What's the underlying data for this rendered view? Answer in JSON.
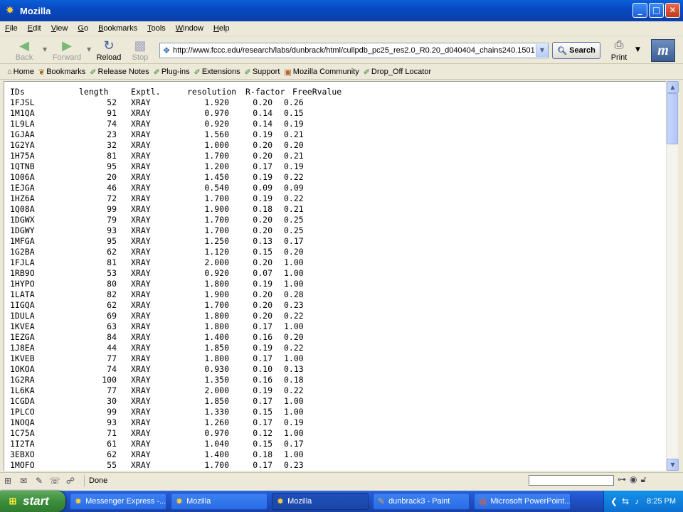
{
  "window": {
    "title": "Mozilla"
  },
  "menu": [
    {
      "label": "File",
      "key": "F",
      "rest": "ile"
    },
    {
      "label": "Edit",
      "key": "E",
      "rest": "dit"
    },
    {
      "label": "View",
      "key": "V",
      "rest": "iew"
    },
    {
      "label": "Go",
      "key": "G",
      "rest": "o"
    },
    {
      "label": "Bookmarks",
      "key": "B",
      "rest": "ookmarks"
    },
    {
      "label": "Tools",
      "key": "T",
      "rest": "ools"
    },
    {
      "label": "Window",
      "key": "W",
      "rest": "indow"
    },
    {
      "label": "Help",
      "key": "H",
      "rest": "elp"
    }
  ],
  "nav": {
    "back_label": "Back",
    "forward_label": "Forward",
    "reload_label": "Reload",
    "stop_label": "Stop",
    "url": "http://www.fccc.edu/research/labs/dunbrack/html/cullpdb_pc25_res2.0_R0.20_d040404_chains240.1501",
    "search_label": "Search",
    "print_label": "Print"
  },
  "bookmarks": [
    {
      "label": "Home",
      "icon": "home-icon"
    },
    {
      "label": "Bookmarks",
      "icon": "bookmarks-icon"
    },
    {
      "label": "Release Notes",
      "icon": "link-icon"
    },
    {
      "label": "Plug-ins",
      "icon": "link-icon"
    },
    {
      "label": "Extensions",
      "icon": "link-icon"
    },
    {
      "label": "Support",
      "icon": "link-icon"
    },
    {
      "label": "Mozilla Community",
      "icon": "folder-icon"
    },
    {
      "label": "Drop_Off Locator",
      "icon": "link-icon"
    }
  ],
  "table": {
    "headers": [
      "IDs",
      "length",
      "Exptl.",
      "resolution",
      "R-factor",
      "FreeRvalue"
    ],
    "rows": [
      [
        "1FJSL",
        "52",
        "XRAY",
        "1.920",
        "0.20",
        "0.26"
      ],
      [
        "1M1QA",
        "91",
        "XRAY",
        "0.970",
        "0.14",
        "0.15"
      ],
      [
        "1L9LA",
        "74",
        "XRAY",
        "0.920",
        "0.14",
        "0.19"
      ],
      [
        "1GJAA",
        "23",
        "XRAY",
        "1.560",
        "0.19",
        "0.21"
      ],
      [
        "1G2YA",
        "32",
        "XRAY",
        "1.000",
        "0.20",
        "0.20"
      ],
      [
        "1H75A",
        "81",
        "XRAY",
        "1.700",
        "0.20",
        "0.21"
      ],
      [
        "1QTNB",
        "95",
        "XRAY",
        "1.200",
        "0.17",
        "0.19"
      ],
      [
        "1O06A",
        "20",
        "XRAY",
        "1.450",
        "0.19",
        "0.22"
      ],
      [
        "1EJGA",
        "46",
        "XRAY",
        "0.540",
        "0.09",
        "0.09"
      ],
      [
        "1HZ6A",
        "72",
        "XRAY",
        "1.700",
        "0.19",
        "0.22"
      ],
      [
        "1Q08A",
        "99",
        "XRAY",
        "1.900",
        "0.18",
        "0.21"
      ],
      [
        "1DGWX",
        "79",
        "XRAY",
        "1.700",
        "0.20",
        "0.25"
      ],
      [
        "1DGWY",
        "93",
        "XRAY",
        "1.700",
        "0.20",
        "0.25"
      ],
      [
        "1MFGA",
        "95",
        "XRAY",
        "1.250",
        "0.13",
        "0.17"
      ],
      [
        "1G2BA",
        "62",
        "XRAY",
        "1.120",
        "0.15",
        "0.20"
      ],
      [
        "1FJLA",
        "81",
        "XRAY",
        "2.000",
        "0.20",
        "1.00"
      ],
      [
        "1RB9O",
        "53",
        "XRAY",
        "0.920",
        "0.07",
        "1.00"
      ],
      [
        "1HYPO",
        "80",
        "XRAY",
        "1.800",
        "0.19",
        "1.00"
      ],
      [
        "1LATA",
        "82",
        "XRAY",
        "1.900",
        "0.20",
        "0.28"
      ],
      [
        "1IGQA",
        "62",
        "XRAY",
        "1.700",
        "0.20",
        "0.23"
      ],
      [
        "1DULA",
        "69",
        "XRAY",
        "1.800",
        "0.20",
        "0.22"
      ],
      [
        "1KVEA",
        "63",
        "XRAY",
        "1.800",
        "0.17",
        "1.00"
      ],
      [
        "1EZGA",
        "84",
        "XRAY",
        "1.400",
        "0.16",
        "0.20"
      ],
      [
        "1J8EA",
        "44",
        "XRAY",
        "1.850",
        "0.19",
        "0.22"
      ],
      [
        "1KVEB",
        "77",
        "XRAY",
        "1.800",
        "0.17",
        "1.00"
      ],
      [
        "1OKOA",
        "74",
        "XRAY",
        "0.930",
        "0.10",
        "0.13"
      ],
      [
        "1G2RA",
        "100",
        "XRAY",
        "1.350",
        "0.16",
        "0.18"
      ],
      [
        "1L6KA",
        "77",
        "XRAY",
        "2.000",
        "0.19",
        "0.22"
      ],
      [
        "1CGDA",
        "30",
        "XRAY",
        "1.850",
        "0.17",
        "1.00"
      ],
      [
        "1PLCO",
        "99",
        "XRAY",
        "1.330",
        "0.15",
        "1.00"
      ],
      [
        "1NOQA",
        "93",
        "XRAY",
        "1.260",
        "0.17",
        "0.19"
      ],
      [
        "1C75A",
        "71",
        "XRAY",
        "0.970",
        "0.12",
        "1.00"
      ],
      [
        "1I2TA",
        "61",
        "XRAY",
        "1.040",
        "0.15",
        "0.17"
      ],
      [
        "3EBXO",
        "62",
        "XRAY",
        "1.400",
        "0.18",
        "1.00"
      ],
      [
        "1MOFO",
        "55",
        "XRAY",
        "1.700",
        "0.17",
        "0.23"
      ]
    ]
  },
  "status": {
    "text": "Done"
  },
  "taskbar": {
    "start_label": "start",
    "tasks": [
      {
        "label": "Messenger Express -...",
        "icon": "mozilla-icon",
        "active": false
      },
      {
        "label": "Mozilla",
        "icon": "mozilla-icon",
        "active": false
      },
      {
        "label": "Mozilla",
        "icon": "mozilla-icon",
        "active": true
      },
      {
        "label": "dunbrack3 - Paint",
        "icon": "paint-icon",
        "active": false
      },
      {
        "label": "Microsoft PowerPoint...",
        "icon": "powerpoint-icon",
        "active": false
      }
    ],
    "clock": "8:25 PM"
  }
}
